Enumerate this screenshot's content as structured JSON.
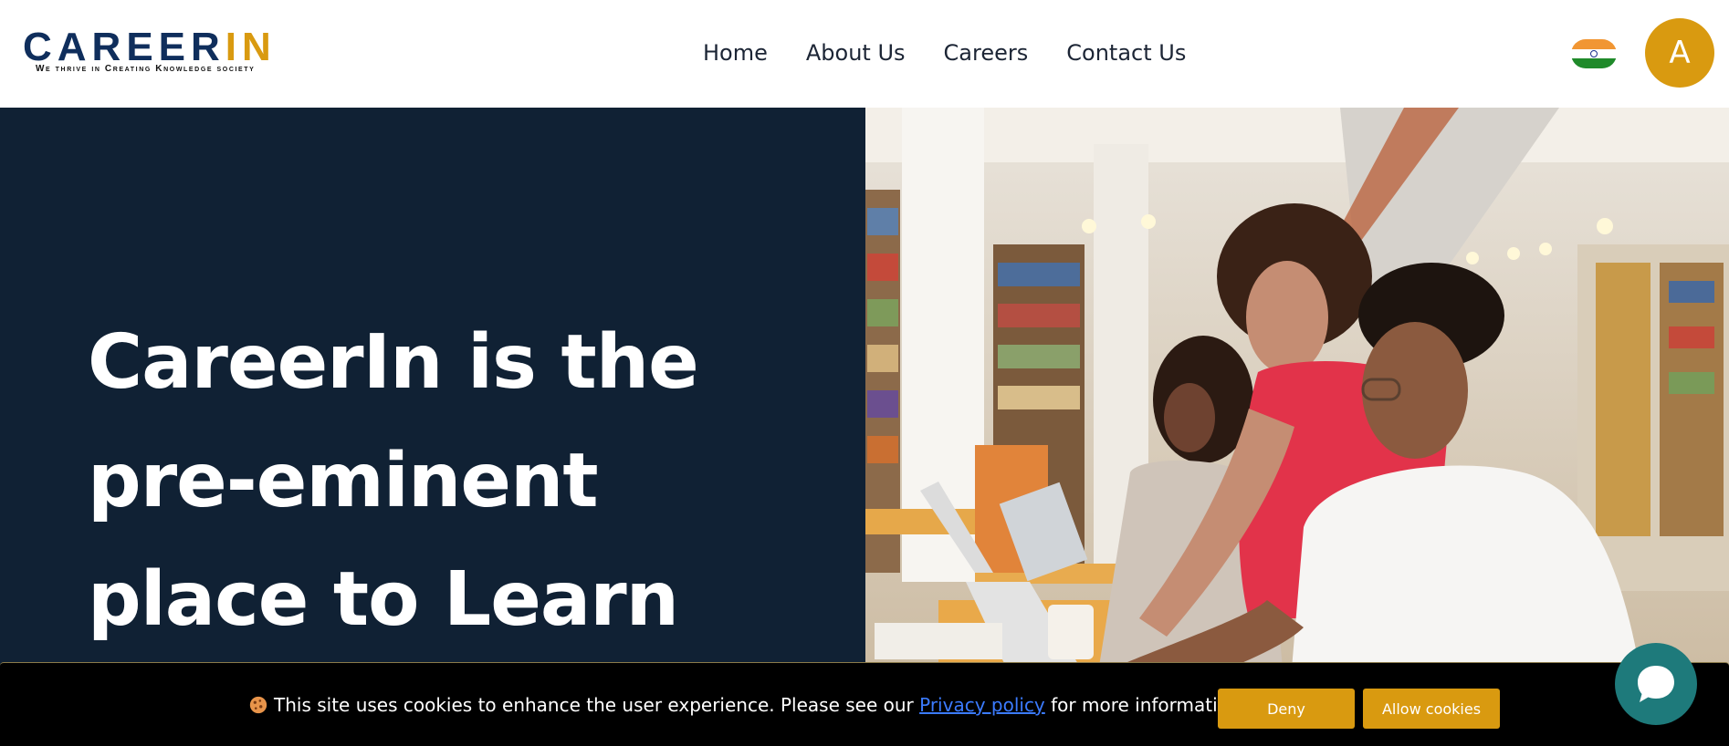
{
  "brand": {
    "logo_text_main": "CAREER",
    "logo_text_accent": "IN",
    "tagline": "We thrive in Creating Knowledge society"
  },
  "nav": {
    "items": [
      "Home",
      "About Us",
      "Careers",
      "Contact Us"
    ]
  },
  "user": {
    "avatar_letter": "A"
  },
  "locale": {
    "flag_icon": "india-flag-icon"
  },
  "hero": {
    "title": "CareerIn is the pre-eminent place to Learn",
    "image": "library-study-photo"
  },
  "cookie": {
    "message_before": "This site uses cookies to enhance the user experience. Please see our",
    "link_text": "Privacy policy",
    "message_after": "for more information.",
    "deny_label": "Deny",
    "allow_label": "Allow cookies",
    "icon": "cookie-icon"
  },
  "chat": {
    "icon": "chat-bubble-icon"
  },
  "colors": {
    "navy": "#102134",
    "gold": "#d99a10",
    "teal": "#1e7a7b",
    "logo_navy": "#0f2e5c"
  }
}
